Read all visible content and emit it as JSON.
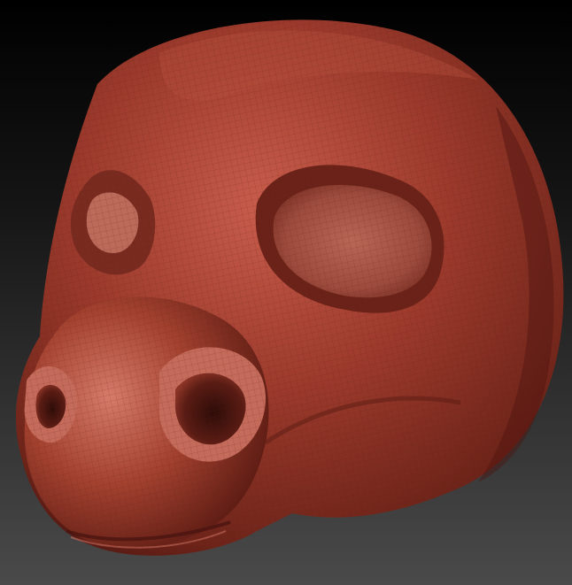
{
  "scene": {
    "background_top": "#000000",
    "background_bottom": "#4a4a4a",
    "material_base": "#9c3a2c",
    "material_highlight": "#e0897a",
    "material_shadow": "#4a1410",
    "wire_color": "#5a1c15"
  },
  "model": {
    "subject": "sculpted-animal-head-mask",
    "icon": "sculpt-mesh-icon"
  }
}
